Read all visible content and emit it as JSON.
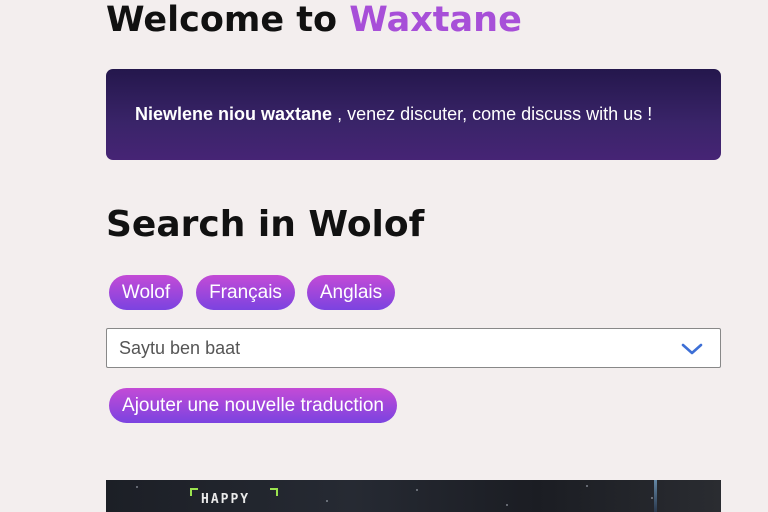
{
  "header": {
    "welcome_prefix": "Welcome to",
    "brand": "Waxtane"
  },
  "banner": {
    "bold_text": "Niewlene niou waxtane",
    "rest_text": ", venez discuter, come discuss with us !"
  },
  "search": {
    "title": "Search in Wolof",
    "language_buttons": [
      "Wolof",
      "Français",
      "Anglais"
    ],
    "select_placeholder": "Saytu ben baat",
    "add_translation_label": "Ajouter une nouvelle traduction"
  },
  "media": {
    "caption": "HAPPY"
  },
  "colors": {
    "brand": "#a74fd8",
    "banner_dark": "#24174c",
    "pill_start": "#c34bd6",
    "pill_end": "#7b43e0",
    "chevron": "#3d6fd6",
    "page_bg": "#f3eeee"
  },
  "icons": {
    "select_chevron": "chevron-down-icon"
  }
}
